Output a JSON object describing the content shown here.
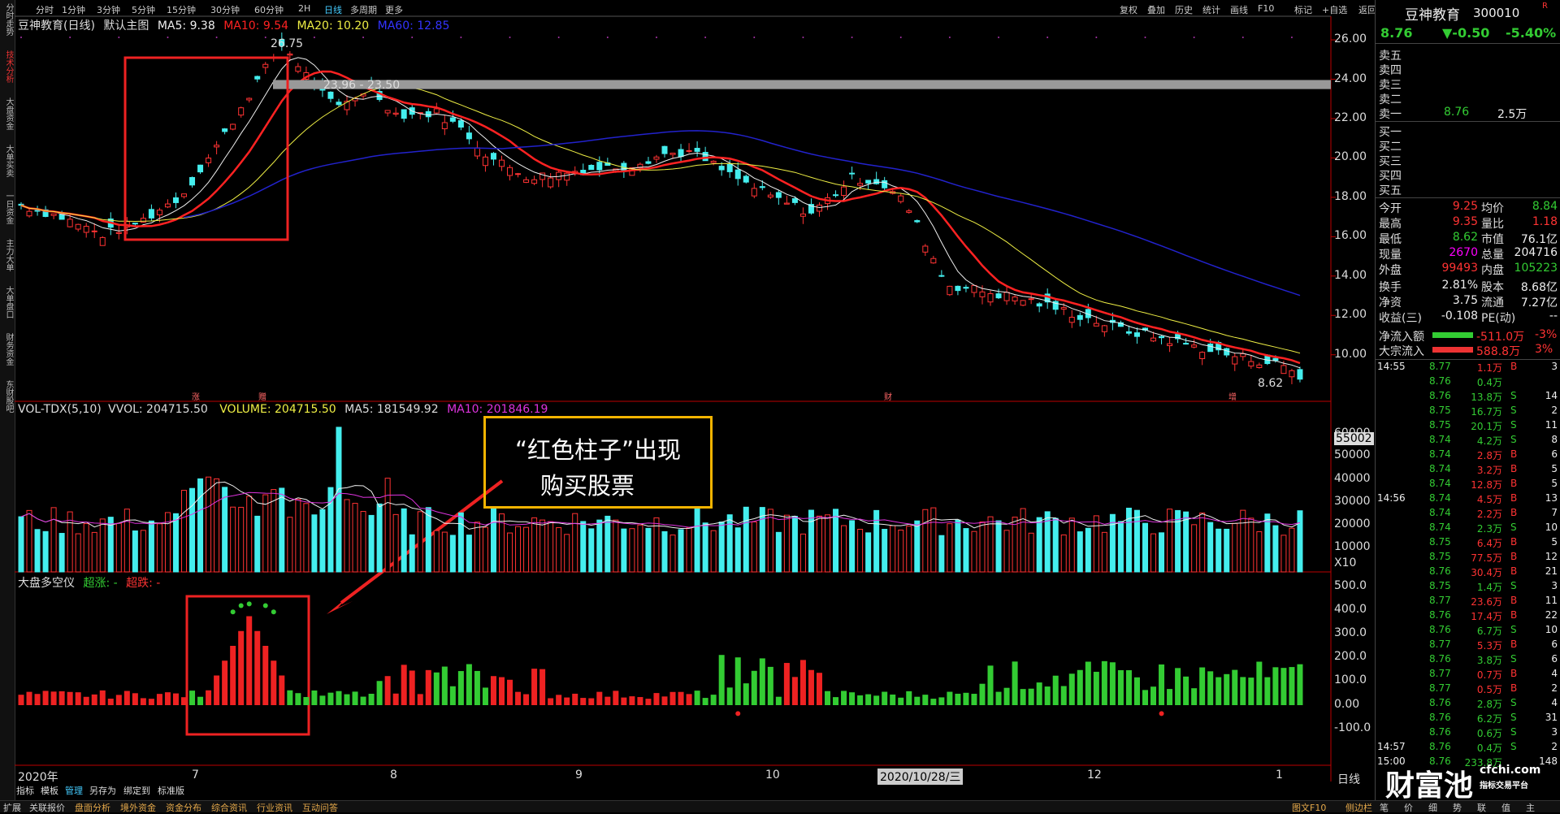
{
  "left_sidebar": [
    "分时走势",
    "技术分析",
    "大盘资金",
    "大单买卖",
    "一日资金",
    "主力大单",
    "大单盘口",
    "财务资金",
    "东财股吧"
  ],
  "top_tabs": [
    "分时",
    "1分钟",
    "3分钟",
    "5分钟",
    "15分钟",
    "30分钟",
    "60分钟",
    "2H",
    "日线",
    "多周期",
    "更多"
  ],
  "top_tools": [
    "复权",
    "叠加",
    "历史",
    "统计",
    "画线",
    "F10",
    "标记",
    "+自选",
    "返回"
  ],
  "main_legend": {
    "name": "豆神教育(日线)",
    "theme": "默认主图",
    "ma5": "MA5: 9.38",
    "ma10": "MA10: 9.54",
    "ma20": "MA20: 10.20",
    "ma60": "MA60: 12.85"
  },
  "main_labels": {
    "high": "26.75",
    "resistance": "23.96 - 23.50",
    "low": "8.62"
  },
  "main_marks": [
    "涨",
    "赠",
    "财",
    "增"
  ],
  "price_axis": [
    "26.00",
    "24.00",
    "22.00",
    "20.00",
    "18.00",
    "16.00",
    "14.00",
    "12.00",
    "10.00"
  ],
  "vol_legend": {
    "name": "VOL-TDX(5,10)",
    "vvol": "VVOL: 204715.50",
    "volume": "VOLUME: 204715.50",
    "ma5": "MA5: 181549.92",
    "ma10": "MA10: 201846.19"
  },
  "vol_axis": [
    "60000",
    "55002",
    "50000",
    "40000",
    "30000",
    "20000",
    "10000",
    "X10"
  ],
  "ind_legend": {
    "name": "大盘多空仪",
    "up": "超涨: -",
    "down": "超跌: -"
  },
  "ind_axis": [
    "500.0",
    "400.0",
    "300.0",
    "200.0",
    "100.0",
    "0.00",
    "-100.0"
  ],
  "annotation": {
    "line1": "“红色柱子”出现",
    "line2": "购买股票"
  },
  "x_axis": [
    "2020年",
    "7",
    "8",
    "9",
    "10",
    "2020/10/28/三",
    "12",
    "1"
  ],
  "period": "日线",
  "bottom_tabs": [
    "扩展",
    "关联报价",
    "盘面分析",
    "境外资金",
    "资金分布",
    "综合资讯",
    "行业资讯",
    "互动问答"
  ],
  "bottom_tabs2": [
    "指标",
    "模板",
    "管理",
    "另存为",
    "绑定到",
    "标准版"
  ],
  "bottom_right": [
    "图文F10",
    "侧边栏",
    "笔",
    "价",
    "细",
    "势",
    "联",
    "值",
    "主"
  ],
  "quote": {
    "name": "豆神教育",
    "code": "300010",
    "flag": "R",
    "price": "8.76",
    "change": "▼-0.50",
    "pct": "-5.40%",
    "asks": [
      {
        "l": "卖五",
        "p": "",
        "v": ""
      },
      {
        "l": "卖四",
        "p": "",
        "v": ""
      },
      {
        "l": "卖三",
        "p": "",
        "v": ""
      },
      {
        "l": "卖二",
        "p": "",
        "v": ""
      },
      {
        "l": "卖一",
        "p": "8.76",
        "v": "2.5万"
      }
    ],
    "bids": [
      {
        "l": "买一",
        "p": "",
        "v": ""
      },
      {
        "l": "买二",
        "p": "",
        "v": ""
      },
      {
        "l": "买三",
        "p": "",
        "v": ""
      },
      {
        "l": "买四",
        "p": "",
        "v": ""
      },
      {
        "l": "买五",
        "p": "",
        "v": ""
      }
    ],
    "stats": [
      [
        "今开",
        "9.25",
        "均价",
        "8.84"
      ],
      [
        "最高",
        "9.35",
        "量比",
        "1.18"
      ],
      [
        "最低",
        "8.62",
        "市值",
        "76.1亿"
      ],
      [
        "现量",
        "2670",
        "总量",
        "204716"
      ],
      [
        "外盘",
        "99493",
        "内盘",
        "105223"
      ],
      [
        "换手",
        "2.81%",
        "股本",
        "8.68亿"
      ],
      [
        "净资",
        "3.75",
        "流通",
        "7.27亿"
      ],
      [
        "收益(三)",
        "-0.108",
        "PE(动)",
        "--"
      ]
    ],
    "flow": [
      {
        "l": "净流入额",
        "v": "-511.0万",
        "p": "-3%"
      },
      {
        "l": "大宗流入",
        "v": "588.8万",
        "p": "3%"
      }
    ],
    "ticks": [
      [
        "14:55",
        "8.77",
        "1.1万",
        "B",
        "3"
      ],
      [
        "",
        "8.76",
        "0.4万",
        "",
        ""
      ],
      [
        "",
        "8.76",
        "13.8万",
        "S",
        "14"
      ],
      [
        "",
        "8.75",
        "16.7万",
        "S",
        "2"
      ],
      [
        "",
        "8.75",
        "20.1万",
        "S",
        "11"
      ],
      [
        "",
        "8.74",
        "4.2万",
        "S",
        "8"
      ],
      [
        "",
        "8.74",
        "2.8万",
        "B",
        "6"
      ],
      [
        "",
        "8.74",
        "3.2万",
        "B",
        "5"
      ],
      [
        "",
        "8.74",
        "12.8万",
        "B",
        "5"
      ],
      [
        "14:56",
        "8.74",
        "4.5万",
        "B",
        "13"
      ],
      [
        "",
        "8.74",
        "2.2万",
        "B",
        "7"
      ],
      [
        "",
        "8.74",
        "2.3万",
        "S",
        "10"
      ],
      [
        "",
        "8.75",
        "6.4万",
        "B",
        "5"
      ],
      [
        "",
        "8.75",
        "77.5万",
        "B",
        "12"
      ],
      [
        "",
        "8.76",
        "30.4万",
        "B",
        "21"
      ],
      [
        "",
        "8.75",
        "1.4万",
        "S",
        "3"
      ],
      [
        "",
        "8.77",
        "23.6万",
        "B",
        "11"
      ],
      [
        "",
        "8.76",
        "17.4万",
        "B",
        "22"
      ],
      [
        "",
        "8.76",
        "6.7万",
        "S",
        "10"
      ],
      [
        "",
        "8.77",
        "5.3万",
        "B",
        "6"
      ],
      [
        "",
        "8.76",
        "3.8万",
        "S",
        "6"
      ],
      [
        "",
        "8.77",
        "0.7万",
        "B",
        "4"
      ],
      [
        "",
        "8.77",
        "0.5万",
        "B",
        "2"
      ],
      [
        "",
        "8.76",
        "2.8万",
        "S",
        "4"
      ],
      [
        "",
        "8.76",
        "6.2万",
        "S",
        "31"
      ],
      [
        "",
        "8.76",
        "0.6万",
        "S",
        "3"
      ],
      [
        "14:57",
        "8.76",
        "0.4万",
        "S",
        "2"
      ],
      [
        "15:00",
        "8.76",
        "233.8万",
        "",
        "148"
      ]
    ]
  },
  "watermark": {
    "cn": "财富池",
    "url": "cfchi.com",
    "sub": "指标交易平台"
  }
}
